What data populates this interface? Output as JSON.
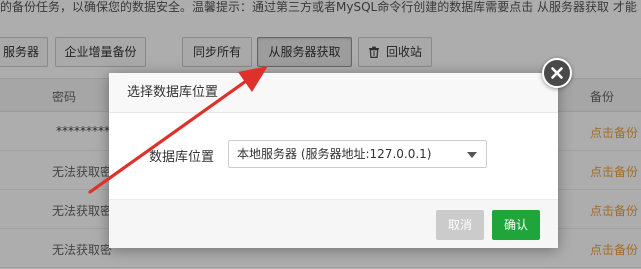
{
  "page": {
    "tip_text": "的备份任务，以确保您的数据安全。温馨提示：通过第三方或者MySQL命令行创建的数据库需要点击 从服务器获取 才能"
  },
  "toolbar": {
    "server_btn": "服务器",
    "incremental_backup_btn": "企业增量备份",
    "sync_all_btn": "同步所有",
    "fetch_from_server_btn": "从服务器获取",
    "recycle_bin_btn": "回收站"
  },
  "table": {
    "headers": {
      "password": "密码",
      "backup": "备份"
    },
    "rows": [
      {
        "password": "**********",
        "backup": "点击备份"
      },
      {
        "password": "无法获取密",
        "backup": "点击备份"
      },
      {
        "password": "无法获取密",
        "backup": "点击备份"
      },
      {
        "password": "无法获取密",
        "backup": "点击备份"
      }
    ]
  },
  "dialog": {
    "title": "选择数据库位置",
    "field_label": "数据库位置",
    "select_value": "本地服务器 (服务器地址:127.0.0.1)",
    "cancel_label": "取消",
    "confirm_label": "确认"
  },
  "colors": {
    "annotation_arrow": "#e0302a",
    "confirm_button": "#20a53a",
    "link_orange": "#f0a040"
  },
  "icons": {
    "close": "close-icon",
    "recycle": "trash-icon",
    "dropdown": "chevron-down-icon"
  }
}
